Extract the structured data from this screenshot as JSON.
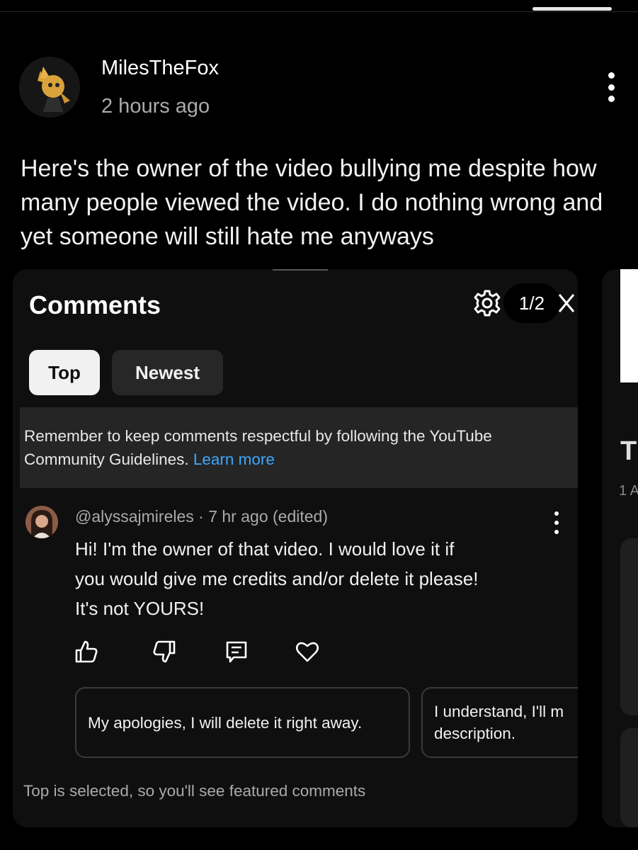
{
  "post": {
    "author": "MilesTheFox",
    "time": "2 hours ago",
    "text": "Here's the owner of the video bullying me despite how many people viewed the video. I do nothing wrong and yet someone will still hate me anyways",
    "menu_icon": "more-vert-icon"
  },
  "screenshot": {
    "title": "Comments",
    "pager": "1/2",
    "filters": [
      {
        "label": "Top",
        "selected": true
      },
      {
        "label": "Newest",
        "selected": false
      }
    ],
    "notice": {
      "text": "Remember to keep comments respectful by following the YouTube Community Guidelines.",
      "link": "Learn more"
    },
    "comment": {
      "meta": "@alyssajmireles · 7 hr ago (edited)",
      "line1": "Hi! I'm the owner of that video. I would love it if",
      "line2": "you would give me credits and/or delete it please!",
      "line3": "It's not YOURS!"
    },
    "suggestions": [
      "My apologies, I will delete it right away.",
      "I understand, I'll m description."
    ],
    "suggestion2_line1": "I understand, I'll m",
    "suggestion2_line2": "description.",
    "footer": "Top is selected, so you'll see featured comments",
    "right_peek": {
      "letter": "T",
      "sub": "1 A"
    }
  },
  "colors": {
    "background": "#000000",
    "card": "#0f0f0f",
    "link": "#3ea6ff",
    "muted": "#aaaaaa"
  }
}
